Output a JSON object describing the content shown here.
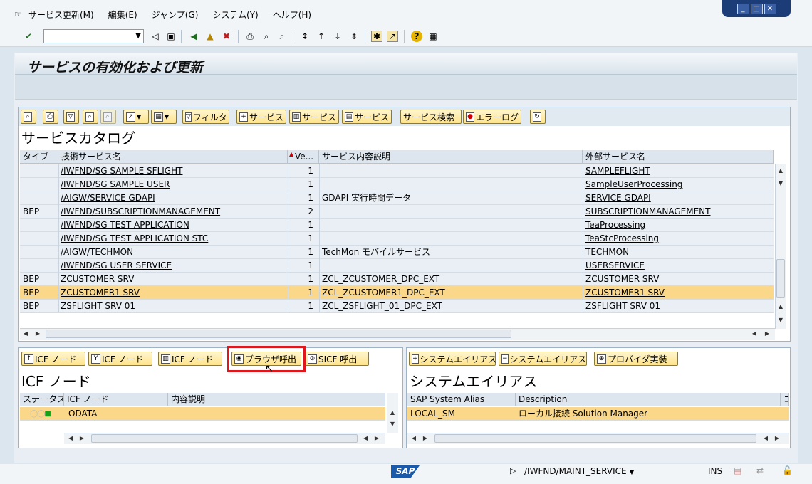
{
  "menu": [
    "サービス更新(M)",
    "編集(E)",
    "ジャンプ(G)",
    "システム(Y)",
    "ヘルプ(H)"
  ],
  "page_title": "サービスの有効化および更新",
  "catalog": {
    "title": "サービスカタログ",
    "toolbar": {
      "filter": "フィルタ",
      "add_service": "サービス",
      "delete_service": "サービス",
      "service_detail": "サービス",
      "service_search": "サービス検索",
      "error_log": "エラーログ"
    },
    "columns": [
      "タイプ",
      "技術サービス名",
      "Ve...",
      "サービス内容説明",
      "外部サービス名"
    ],
    "rows": [
      {
        "type": "",
        "tech": "/IWFND/SG SAMPLE SFLIGHT",
        "ver": "1",
        "desc": "",
        "ext": "SAMPLEFLIGHT",
        "sel": false
      },
      {
        "type": "",
        "tech": "/IWFND/SG SAMPLE USER",
        "ver": "1",
        "desc": "",
        "ext": "SampleUserProcessing",
        "sel": false
      },
      {
        "type": "",
        "tech": "/AIGW/SERVICE GDAPI",
        "ver": "1",
        "desc": "GDAPI 実行時間データ",
        "ext": "SERVICE GDAPI",
        "sel": false
      },
      {
        "type": "BEP",
        "tech": "/IWFND/SUBSCRIPTIONMANAGEMENT",
        "ver": "2",
        "desc": "",
        "ext": "SUBSCRIPTIONMANAGEMENT",
        "sel": false
      },
      {
        "type": "",
        "tech": "/IWFND/SG TEST APPLICATION",
        "ver": "1",
        "desc": "",
        "ext": "TeaProcessing",
        "sel": false
      },
      {
        "type": "",
        "tech": "/IWFND/SG TEST APPLICATION STC",
        "ver": "1",
        "desc": "",
        "ext": "TeaStcProcessing",
        "sel": false
      },
      {
        "type": "",
        "tech": "/AIGW/TECHMON",
        "ver": "1",
        "desc": "TechMon モバイルサービス",
        "ext": "TECHMON",
        "sel": false
      },
      {
        "type": "",
        "tech": "/IWFND/SG USER SERVICE",
        "ver": "1",
        "desc": "",
        "ext": "USERSERVICE",
        "sel": false
      },
      {
        "type": "BEP",
        "tech": "ZCUSTOMER SRV",
        "ver": "1",
        "desc": "ZCL_ZCUSTOMER_DPC_EXT",
        "ext": "ZCUSTOMER SRV",
        "sel": false
      },
      {
        "type": "BEP",
        "tech": "ZCUSTOMER1 SRV",
        "ver": "1",
        "desc": "ZCL_ZCUSTOMER1_DPC_EXT",
        "ext": "ZCUSTOMER1 SRV",
        "sel": true
      },
      {
        "type": "BEP",
        "tech": "ZSFLIGHT SRV 01",
        "ver": "1",
        "desc": "ZCL_ZSFLIGHT_01_DPC_EXT",
        "ext": "ZSFLIGHT SRV 01",
        "sel": false
      }
    ]
  },
  "icf": {
    "title": "ICF ノード",
    "buttons": [
      "ICF ノード",
      "ICF ノード",
      "ICF ノード",
      "ブラウザ呼出",
      "SICF 呼出"
    ],
    "columns": [
      "ステータス",
      "ICF ノード",
      "内容説明"
    ],
    "rows": [
      {
        "node": "ODATA",
        "desc": ""
      }
    ]
  },
  "alias": {
    "title": "システムエイリアス",
    "buttons": [
      "システムエイリアス",
      "システムエイリアス",
      "プロバイダ実装"
    ],
    "columns": [
      "SAP System Alias",
      "Description",
      "コ"
    ],
    "rows": [
      {
        "alias": "LOCAL_SM",
        "desc": "ローカル接続 Solution Manager"
      }
    ]
  },
  "status": {
    "logo": "SAP",
    "transaction": "/IWFND/MAINT_SERVICE",
    "mode": "INS"
  }
}
